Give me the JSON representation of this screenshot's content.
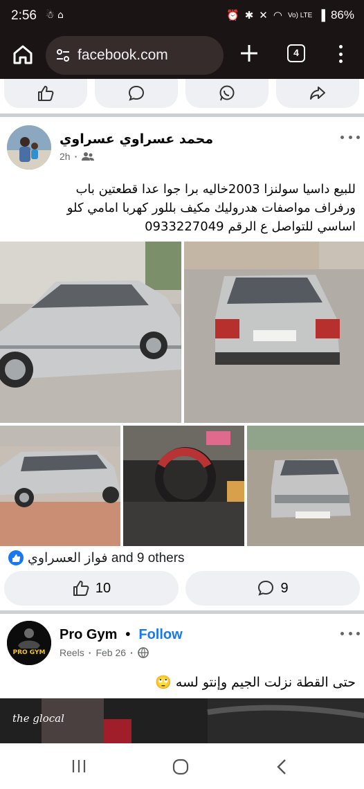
{
  "status_bar": {
    "time": "2:56",
    "battery": "86%",
    "network": "Vo) LTE"
  },
  "browser": {
    "url": "facebook.com",
    "tab_count": "4"
  },
  "post1": {
    "author": "محمد عسراوي عسراوي",
    "time": "2h",
    "text_lines": [
      "للبيع داسيا سولنزا 2003خاليه برا جوا عدا قطعتين باب",
      "ورفراف مواصفات هدروليك مكيف بللور كهربا امامي كلو",
      "اساسي للتواصل ع الرقم 0933227049"
    ],
    "reactions_text": "فواز العسراوي and 9 others",
    "like_count": "10",
    "comment_count": "9"
  },
  "post2": {
    "author": "Pro Gym",
    "follow_label": "Follow",
    "source": "Reels",
    "date": "Feb 26",
    "text": "حتى القطة نزلت الجيم وإنتو لسه 🙄",
    "avatar_text": "PRO GYM",
    "watermark": "the glocal"
  },
  "colors": {
    "chrome_bg": "#1b1414",
    "fb_blue": "#1877f2",
    "pill_bg": "#eef0f3",
    "meta_gray": "#65676b"
  }
}
